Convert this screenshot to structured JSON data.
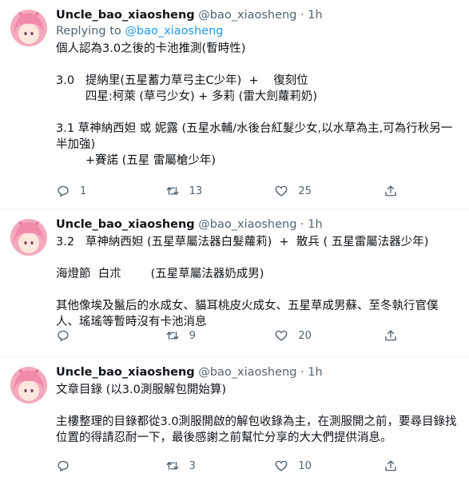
{
  "tweets": [
    {
      "name": "Uncle_bao_xiaosheng",
      "handle": "@bao_xiaosheng",
      "dot": "·",
      "time": "1h",
      "reply_label": "Replying to",
      "reply_mention": "@bao_xiaosheng",
      "lines": [
        "個人認為3.0之後的卡池推測(暫時性)",
        "",
        "3.0   提納里(五星蓄力草弓主C少年)  +    復刻位",
        "        四星:柯萊 (草弓少女) + 多莉 (雷大劍蘿莉奶)",
        "",
        "3.1   草神納西妲 或 妮露 (五星水輔/水後台紅髮少女,以水草為主,可為行秋另一半加強)",
        "        +賽諾 (五星 雷屬槍少年)"
      ],
      "replies": "1",
      "retweets": "13",
      "likes": "25"
    },
    {
      "name": "Uncle_bao_xiaosheng",
      "handle": "@bao_xiaosheng",
      "dot": "·",
      "time": "1h",
      "lines": [
        "3.2   草神納西妲 (五星草屬法器白髮蘿莉)  +  散兵 ( 五星雷屬法器少年)",
        "",
        "海燈節  白朮        (五星草屬法器奶成男)",
        "",
        "其他像埃及鬣后的水成女、貓耳桃皮火成女、五星草成男蘇、至冬執行官僕人、瑤瑤等暫時沒有卡池消息"
      ],
      "replies": "",
      "retweets": "9",
      "likes": "20"
    },
    {
      "name": "Uncle_bao_xiaosheng",
      "handle": "@bao_xiaosheng",
      "dot": "·",
      "time": "1h",
      "lines": [
        "文章目錄 (以3.0測服解包開始算)",
        "",
        "主樓整理的目錄都從3.0測服開啟的解包收錄為主，在測服開之前，要尋目錄找位置的得請忍耐一下，最後感謝之前幫忙分享的大大們提供消息。"
      ],
      "replies": "",
      "retweets": "3",
      "likes": "10"
    }
  ],
  "icons": {
    "reply": "comment-bubble-icon",
    "retweet": "retweet-arrows-icon",
    "like": "heart-outline-icon",
    "share": "share-upload-icon"
  },
  "colors": {
    "text": "#0f1419",
    "secondary": "#536471",
    "link": "#1d9bf0",
    "divider": "#eff3f4",
    "avatar_hair": "#f3a9be"
  }
}
